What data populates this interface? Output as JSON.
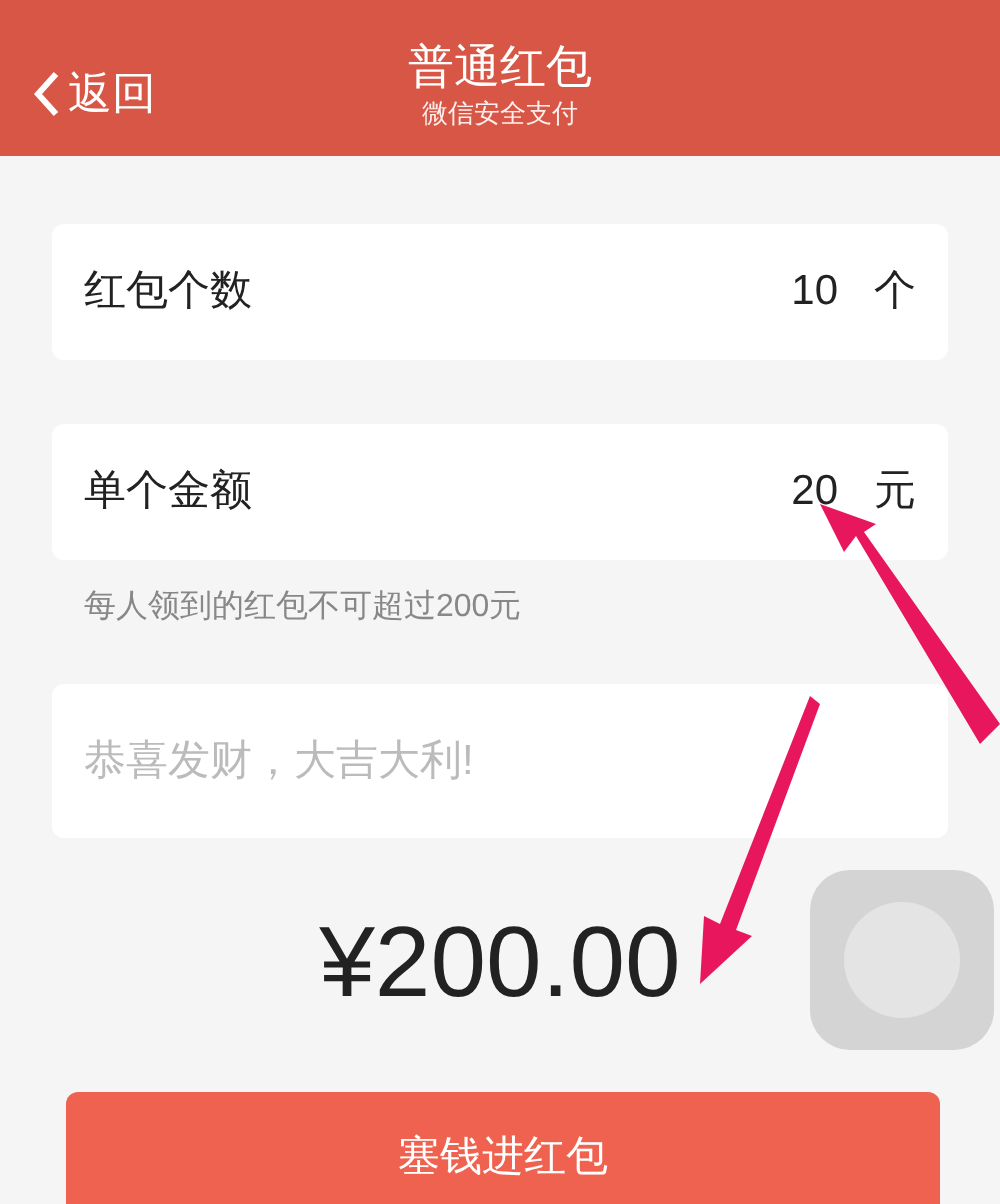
{
  "header": {
    "back": "返回",
    "title": "普通红包",
    "subtitle": "微信安全支付"
  },
  "fields": [
    {
      "label": "红包个数",
      "value": "10",
      "unit": "个"
    },
    {
      "label": "单个金额",
      "value": "20",
      "unit": "元"
    }
  ],
  "hint": "每人领到的红包不可超过200元",
  "message": {
    "placeholder": "恭喜发财，大吉大利!"
  },
  "total": "¥200.00",
  "submit": "塞钱进红包"
}
